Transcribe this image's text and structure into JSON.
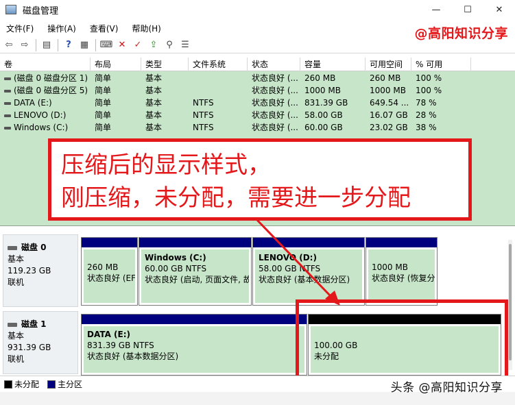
{
  "window": {
    "title": "磁盘管理",
    "controls": [
      "minimize-icon",
      "maximize-icon",
      "close-icon"
    ]
  },
  "menu": [
    "文件(F)",
    "操作(A)",
    "查看(V)",
    "帮助(H)"
  ],
  "watermark_top": "@高阳知识分享",
  "toolbar": {
    "icons": [
      "back-icon",
      "forward-icon",
      "properties-icon",
      "help-icon",
      "view-icon",
      "connect-icon",
      "delete-icon",
      "check-icon",
      "import-icon",
      "search-icon",
      "settings-icon"
    ]
  },
  "columns": [
    "卷",
    "布局",
    "类型",
    "文件系统",
    "状态",
    "容量",
    "可用空间",
    "% 可用"
  ],
  "volumes": [
    {
      "name": "(磁盘 0 磁盘分区 1)",
      "layout": "简单",
      "type": "基本",
      "fs": "",
      "status": "状态良好 (...",
      "capacity": "260 MB",
      "free": "260 MB",
      "pct": "100 %"
    },
    {
      "name": "(磁盘 0 磁盘分区 5)",
      "layout": "简单",
      "type": "基本",
      "fs": "",
      "status": "状态良好 (...",
      "capacity": "1000 MB",
      "free": "1000 MB",
      "pct": "100 %"
    },
    {
      "name": "DATA (E:)",
      "layout": "简单",
      "type": "基本",
      "fs": "NTFS",
      "status": "状态良好 (...",
      "capacity": "831.39 GB",
      "free": "649.54 ...",
      "pct": "78 %"
    },
    {
      "name": "LENOVO (D:)",
      "layout": "简单",
      "type": "基本",
      "fs": "NTFS",
      "status": "状态良好 (...",
      "capacity": "58.00 GB",
      "free": "16.07 GB",
      "pct": "28 %"
    },
    {
      "name": "Windows (C:)",
      "layout": "简单",
      "type": "基本",
      "fs": "NTFS",
      "status": "状态良好 (...",
      "capacity": "60.00 GB",
      "free": "23.02 GB",
      "pct": "38 %"
    }
  ],
  "callout": {
    "line1": "压缩后的显示样式，",
    "line2": "刚压缩，未分配，需要进一步分配"
  },
  "disks": [
    {
      "name": "磁盘 0",
      "type": "基本",
      "size": "119.23 GB",
      "state": "联机",
      "partitions": [
        {
          "title": "",
          "size": "260 MB",
          "status": "状态良好 (EF"
        },
        {
          "title": "Windows  (C:)",
          "size": "60.00 GB NTFS",
          "status": "状态良好 (启动, 页面文件, 故"
        },
        {
          "title": "LENOVO  (D:)",
          "size": "58.00 GB NTFS",
          "status": "状态良好 (基本数据分区)"
        },
        {
          "title": "",
          "size": "1000 MB",
          "status": "状态良好 (恢复分"
        }
      ]
    },
    {
      "name": "磁盘 1",
      "type": "基本",
      "size": "931.39 GB",
      "state": "联机",
      "partitions": [
        {
          "title": "DATA  (E:)",
          "size": "831.39 GB NTFS",
          "status": "状态良好 (基本数据分区)"
        },
        {
          "title": "",
          "size": "100.00 GB",
          "status": "未分配"
        }
      ]
    }
  ],
  "legend": {
    "unallocated": "未分配",
    "primary": "主分区",
    "unallocated_color": "#000000",
    "primary_color": "#00007f"
  },
  "watermark_bottom": "头条 @高阳知识分享"
}
